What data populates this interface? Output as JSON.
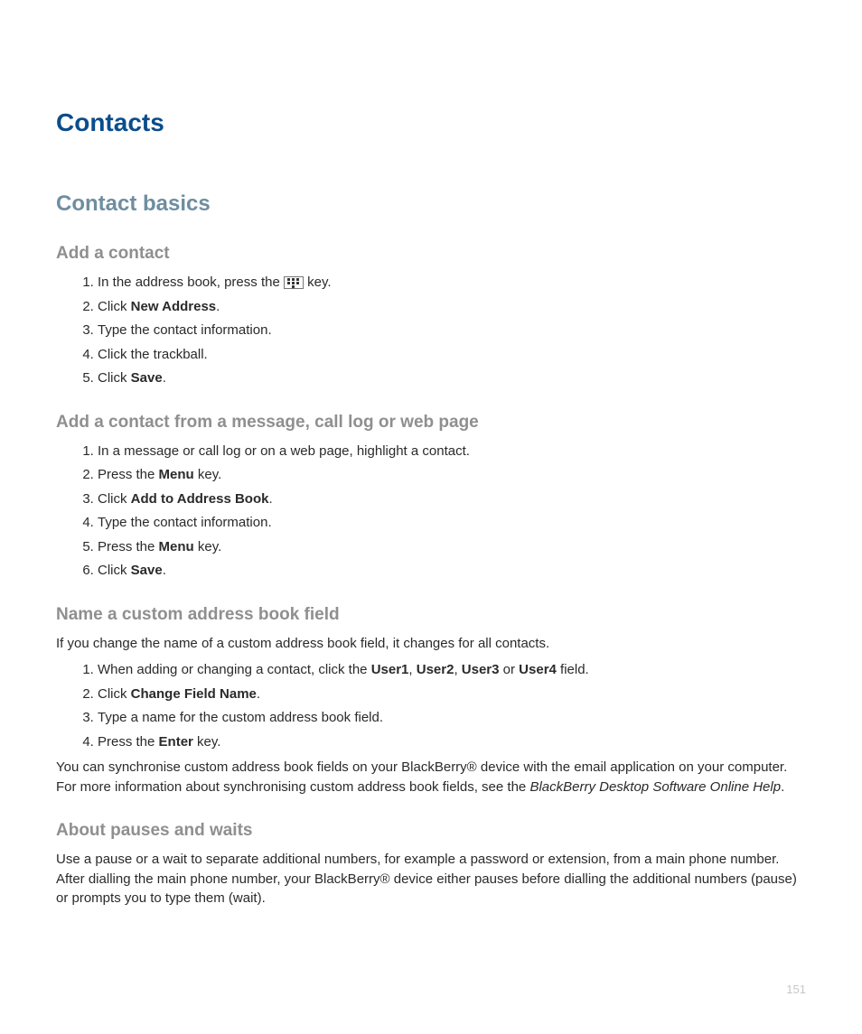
{
  "title": "Contacts",
  "section": "Contact basics",
  "pageNumber": "151",
  "addContact": {
    "heading": "Add a contact",
    "steps": {
      "s1_a": "In the address book, press the ",
      "s1_b": " key.",
      "s2_a": "Click ",
      "s2_bold": "New Address",
      "s2_b": ".",
      "s3": "Type the contact information.",
      "s4": "Click the trackball.",
      "s5_a": "Click ",
      "s5_bold": "Save",
      "s5_b": "."
    }
  },
  "addFromMessage": {
    "heading": "Add a contact from a message, call log or web page",
    "steps": {
      "s1": "In a message or call log or on a web page, highlight a contact.",
      "s2_a": "Press the ",
      "s2_bold": "Menu",
      "s2_b": " key.",
      "s3_a": "Click ",
      "s3_bold": "Add to Address Book",
      "s3_b": ".",
      "s4": "Type the contact information.",
      "s5_a": "Press the ",
      "s5_bold": "Menu",
      "s5_b": " key.",
      "s6_a": "Click ",
      "s6_bold": "Save",
      "s6_b": "."
    }
  },
  "customField": {
    "heading": "Name a custom address book field",
    "intro": "If you change the name of a custom address book field, it changes for all contacts.",
    "steps": {
      "s1_a": "When adding or changing a contact, click the ",
      "s1_u1": "User1",
      "s1_c1": ", ",
      "s1_u2": "User2",
      "s1_c2": ", ",
      "s1_u3": "User3",
      "s1_c3": " or ",
      "s1_u4": "User4",
      "s1_b": " field.",
      "s2_a": "Click ",
      "s2_bold": "Change Field Name",
      "s2_b": ".",
      "s3": "Type a name for the custom address book field.",
      "s4_a": "Press the ",
      "s4_bold": "Enter",
      "s4_b": " key."
    },
    "outro_a": "You can synchronise custom address book fields on your BlackBerry® device with the email application on your computer. For more information about synchronising custom address book fields, see the ",
    "outro_italic": "BlackBerry Desktop Software Online Help",
    "outro_b": "."
  },
  "pausesWaits": {
    "heading": "About pauses and waits",
    "body": "Use a pause or a wait to separate additional numbers, for example a password or extension, from a main phone number. After dialling the main phone number, your BlackBerry® device either pauses before dialling the additional numbers (pause) or prompts you to type them (wait)."
  }
}
